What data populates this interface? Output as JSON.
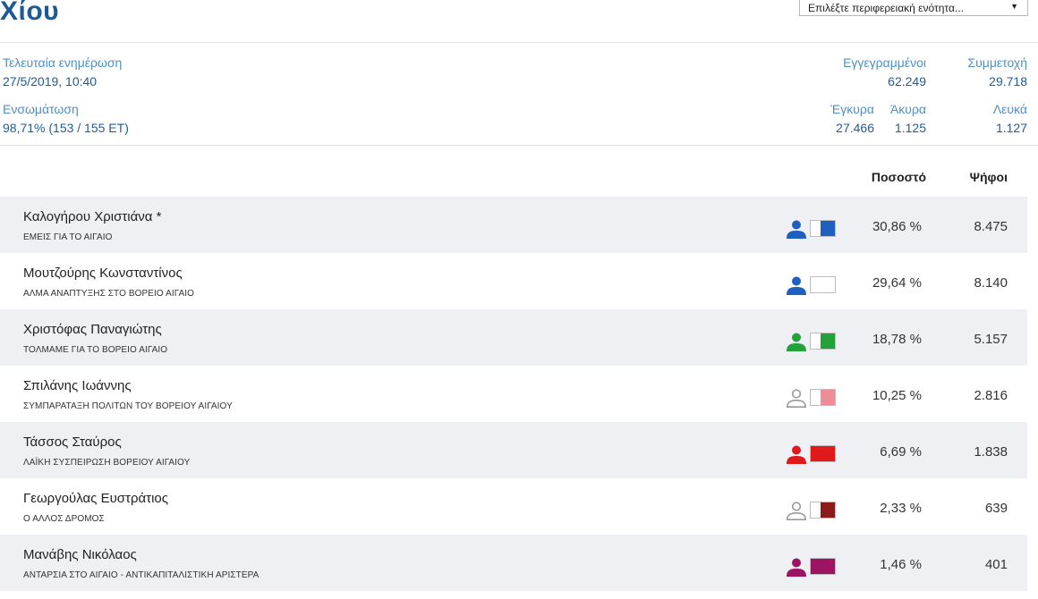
{
  "header": {
    "title": "Χίου",
    "region_select": {
      "value": "Επιλέξτε περιφερειακή ενότητα..."
    }
  },
  "meta": {
    "last_update_label": "Τελευταία ενημέρωση",
    "last_update_value": "27/5/2019, 10:40",
    "integration_label": "Ενσωμάτωση",
    "integration_value": "98,71% (153 / 155 ΕΤ)",
    "registered_label": "Εγγεγραμμένοι",
    "registered_value": "62.249",
    "turnout_label": "Συμμετοχή",
    "turnout_value": "29.718",
    "valid_label": "Έγκυρα",
    "valid_value": "27.466",
    "invalid_label": "Άκυρα",
    "invalid_value": "1.125",
    "blank_label": "Λευκά",
    "blank_value": "1.127"
  },
  "table": {
    "col_percent": "Ποσοστό",
    "col_votes": "Ψήφοι",
    "rows": [
      {
        "name": "Καλογήρου Χριστιάνα *",
        "party": "ΕΜΕΙΣ ΓΙΑ ΤΟ ΑΙΓΑΙΟ",
        "percent": "30,86 %",
        "votes": "8.475",
        "icon_color": "#1f5fbf",
        "icon_style": "filled",
        "swatch_color": "#1f5fbf",
        "swatch_fill": 0.6
      },
      {
        "name": "Μουτζούρης Κωνσταντίνος",
        "party": "ΑΛΜΑ ΑΝΑΠΤΥΞΗΣ ΣΤΟ ΒΟΡΕΙΟ ΑΙΓΑΙΟ",
        "percent": "29,64 %",
        "votes": "8.140",
        "icon_color": "#1f5fbf",
        "icon_style": "filled",
        "swatch_color": "#ffffff",
        "swatch_fill": 0.0
      },
      {
        "name": "Χριστόφας Παναγιώτης",
        "party": "ΤΟΛΜΑΜΕ ΓΙΑ ΤΟ ΒΟΡΕΙΟ ΑΙΓΑΙΟ",
        "percent": "18,78 %",
        "votes": "5.157",
        "icon_color": "#23a23a",
        "icon_style": "filled",
        "swatch_color": "#23a23a",
        "swatch_fill": 0.6
      },
      {
        "name": "Σπιλάνης Ιωάννης",
        "party": "ΣΥΜΠΑΡΑΤΑΞΗ ΠΟΛΙΤΩΝ ΤΟΥ ΒΟΡΕΙΟΥ ΑΙΓΑΙΟΥ",
        "percent": "10,25 %",
        "votes": "2.816",
        "icon_color": "#9a9a9a",
        "icon_style": "outline",
        "swatch_color": "#ee8c98",
        "swatch_fill": 0.6
      },
      {
        "name": "Τάσσος Σταύρος",
        "party": "ΛΑΪΚΗ ΣΥΣΠΕΙΡΩΣΗ ΒΟΡΕΙΟΥ ΑΙΓΑΙΟΥ",
        "percent": "6,69 %",
        "votes": "1.838",
        "icon_color": "#e01a1a",
        "icon_style": "filled",
        "swatch_color": "#e01a1a",
        "swatch_fill": 1.0
      },
      {
        "name": "Γεωργούλας Ευστράτιος",
        "party": "Ο ΑΛΛΟΣ ΔΡΟΜΟΣ",
        "percent": "2,33 %",
        "votes": "639",
        "icon_color": "#9a9a9a",
        "icon_style": "outline",
        "swatch_color": "#8b1a1a",
        "swatch_fill": 0.6
      },
      {
        "name": "Μανάβης Νικόλαος",
        "party": "ΑΝΤΑΡΣΙΑ ΣΤΟ ΑΙΓΑΙΟ - ΑΝΤΙΚΑΠΙΤΑΛΙΣΤΙΚΗ ΑΡΙΣΤΕΡΑ",
        "percent": "1,46 %",
        "votes": "401",
        "icon_color": "#9c1565",
        "icon_style": "filled",
        "swatch_color": "#9c1565",
        "swatch_fill": 1.0
      }
    ]
  }
}
